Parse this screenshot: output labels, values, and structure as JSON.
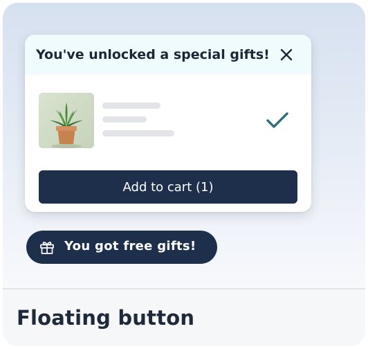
{
  "popup": {
    "title": "You've unlocked a special gifts!",
    "close_icon": "close-icon",
    "product": {
      "image": "potted-plant-image",
      "status_icon": "check-icon"
    },
    "add_to_cart_label": "Add to cart (1)"
  },
  "floating_button": {
    "icon": "gift-icon",
    "label": "You got free gifts!"
  },
  "footer": {
    "title": "Floating button"
  },
  "colors": {
    "primary_dark": "#1e2f4b",
    "header_tint": "#effbfd",
    "check_accent": "#2f6f7a",
    "background_gradient_top": "#d6e1f0"
  }
}
